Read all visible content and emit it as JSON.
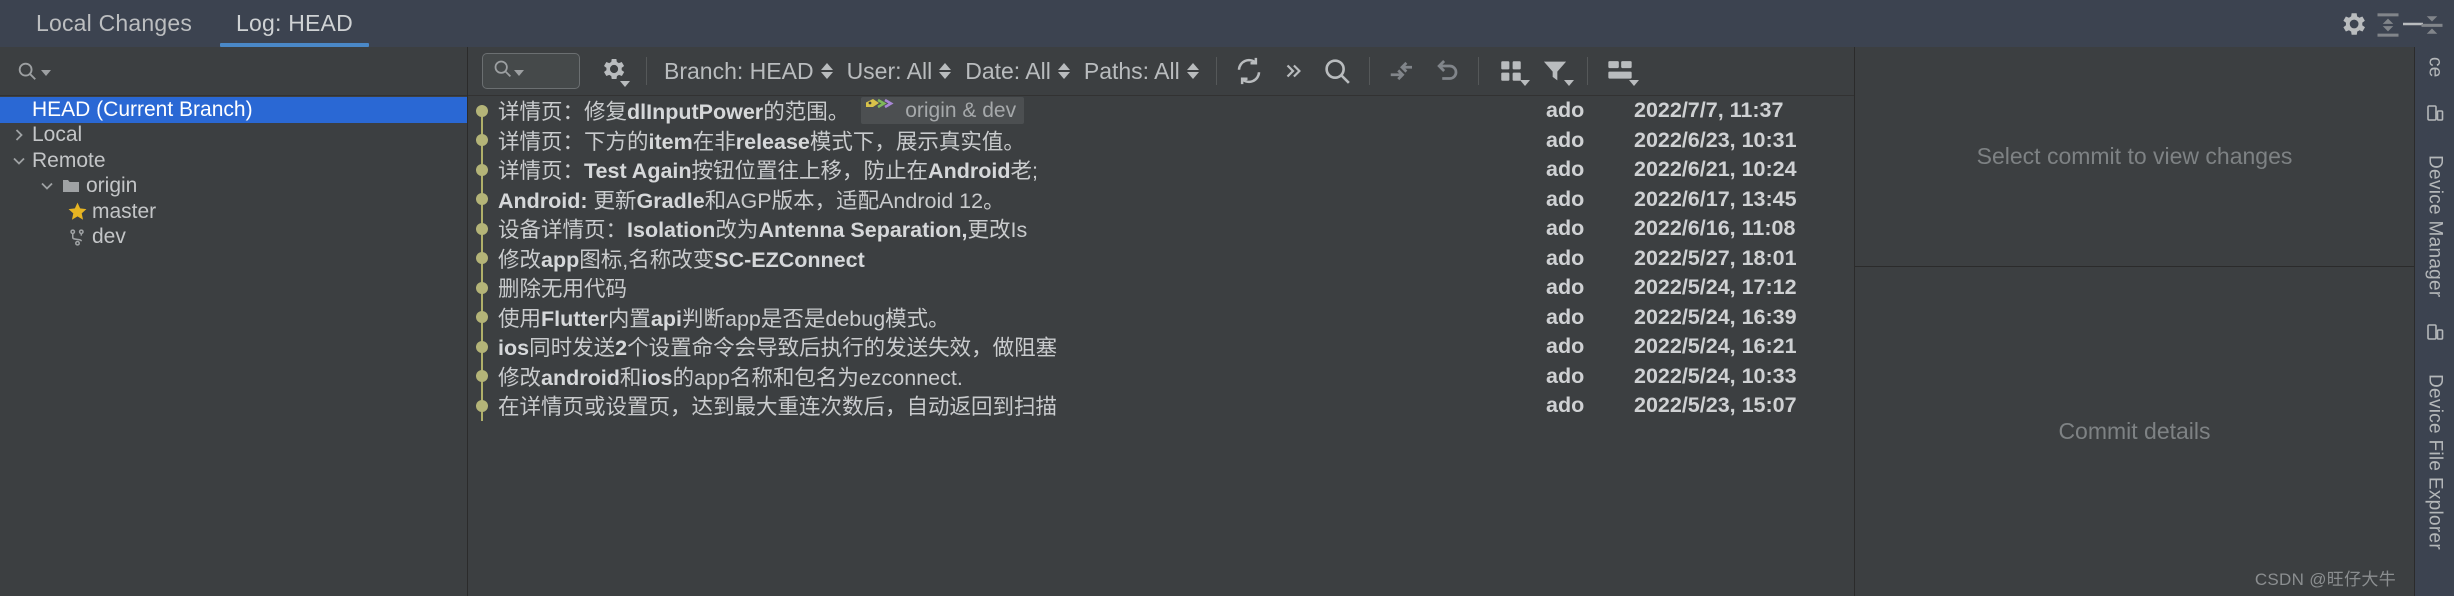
{
  "window": {
    "tabs": [
      {
        "label": "Local Changes",
        "active": false
      },
      {
        "label": "Log: HEAD",
        "active": true
      }
    ],
    "controls": [
      {
        "name": "settings-icon",
        "glyph": "gear"
      },
      {
        "name": "minimize-icon",
        "glyph": "minus"
      }
    ]
  },
  "left_panel": {
    "search_placeholder": "",
    "tree": [
      {
        "label": "HEAD (Current Branch)",
        "indent": 1,
        "twisty": "",
        "icon": "",
        "selected": true
      },
      {
        "label": "Local",
        "indent": 1,
        "twisty": "collapsed",
        "icon": "",
        "selected": false
      },
      {
        "label": "Remote",
        "indent": 1,
        "twisty": "expanded",
        "icon": "",
        "selected": false
      },
      {
        "label": "origin",
        "indent": 2,
        "twisty": "expanded",
        "icon": "folder",
        "selected": false
      },
      {
        "label": "master",
        "indent": 3,
        "twisty": "",
        "icon": "star",
        "selected": false
      },
      {
        "label": "dev",
        "indent": 3,
        "twisty": "",
        "icon": "branch",
        "selected": false
      }
    ]
  },
  "log_toolbar": {
    "search_value": "",
    "gear_name": "settings-icon",
    "filters": [
      {
        "label": "Branch: HEAD"
      },
      {
        "label": "User: All"
      },
      {
        "label": "Date: All"
      },
      {
        "label": "Paths: All"
      }
    ],
    "icons_left": [
      {
        "name": "refresh-icon"
      },
      {
        "name": "expand-more-icon"
      },
      {
        "name": "search-icon"
      }
    ],
    "icons_right": [
      {
        "name": "cherry-pick-icon"
      },
      {
        "name": "revert-icon"
      },
      {
        "name": "show-columns-icon"
      },
      {
        "name": "filter-icon"
      },
      {
        "name": "layout-icon"
      }
    ],
    "icons_far_right": [
      {
        "name": "expand-all-icon"
      },
      {
        "name": "collapse-all-icon"
      }
    ]
  },
  "commits": {
    "rows": [
      {
        "subject_plain": "详情页：修复",
        "subject_bold": "dlInputPower",
        "subject_tail": "的范围。",
        "refs": "origin & dev",
        "has_refs": true,
        "author": "ado",
        "date": "2022/7/7, 11:37"
      },
      {
        "subject_plain": "详情页：下方的",
        "subject_bold": "item",
        "subject_tail": "在非",
        "subject_bold2": "release",
        "subject_tail2": "模式下，展示真实值。",
        "has_refs": false,
        "author": "ado",
        "date": "2022/6/23, 10:31"
      },
      {
        "subject_plain": "详情页：",
        "subject_bold": "Test Again",
        "subject_tail": "按钮位置往上移，防止在",
        "subject_bold2": "Android",
        "subject_tail2": "老;",
        "has_refs": false,
        "author": "ado",
        "date": "2022/6/21, 10:24"
      },
      {
        "subject_plain": "",
        "subject_bold": "Android:",
        "subject_tail": " 更新",
        "subject_bold2": "Gradle",
        "subject_tail2": "和AGP版本，适配Android 12。",
        "has_refs": false,
        "author": "ado",
        "date": "2022/6/17, 13:45"
      },
      {
        "subject_plain": "设备详情页：",
        "subject_bold": "Isolation",
        "subject_tail": "改为",
        "subject_bold2": "Antenna Separation,",
        "subject_tail2": "更改Is",
        "has_refs": false,
        "author": "ado",
        "date": "2022/6/16, 11:08"
      },
      {
        "subject_plain": "修改",
        "subject_bold": "app",
        "subject_tail": "图标,名称改变",
        "subject_bold2": "SC-EZConnect",
        "subject_tail2": "",
        "has_refs": false,
        "author": "ado",
        "date": "2022/5/27, 18:01"
      },
      {
        "subject_plain": "删除无用代码",
        "subject_bold": "",
        "subject_tail": "",
        "has_refs": false,
        "author": "ado",
        "date": "2022/5/24, 17:12"
      },
      {
        "subject_plain": "使用",
        "subject_bold": "Flutter",
        "subject_tail": "内置",
        "subject_bold2": "api",
        "subject_tail2": "判断app是否是debug模式。",
        "has_refs": false,
        "author": "ado",
        "date": "2022/5/24, 16:39"
      },
      {
        "subject_plain": "",
        "subject_bold": "ios",
        "subject_tail": "同时发送",
        "subject_bold2": "2",
        "subject_tail2": "个设置命令会导致后执行的发送失效，做阻塞",
        "has_refs": false,
        "author": "ado",
        "date": "2022/5/24, 16:21"
      },
      {
        "subject_plain": "修改",
        "subject_bold": "android",
        "subject_tail": "和",
        "subject_bold2": "ios",
        "subject_tail2": "的app名称和包名为ezconnect.",
        "has_refs": false,
        "author": "ado",
        "date": "2022/5/24, 10:33"
      },
      {
        "subject_plain": "在详情页或设置页，达到最大重连次数后，自动返回到扫描",
        "subject_bold": "",
        "subject_tail": "",
        "has_refs": false,
        "author": "ado",
        "date": "2022/5/23, 15:07"
      }
    ]
  },
  "right_panel": {
    "changes_placeholder": "Select commit to view changes",
    "details_placeholder": "Commit details"
  },
  "right_strip": {
    "items": [
      {
        "label": "ce",
        "name": "device-label-top"
      },
      {
        "label": "Device Manager",
        "name": "device-manager-tool"
      },
      {
        "label": "Device File Explorer",
        "name": "device-file-explorer-tool"
      }
    ]
  },
  "watermark": {
    "text": "CSDN @旺仔大牛"
  },
  "colors": {
    "accent_blue": "#2a68d4",
    "tab_underline": "#4a88c7",
    "graph_olive": "#b4b478",
    "panel_bg": "#3c3f41",
    "tabbar_bg": "#3c4350"
  }
}
